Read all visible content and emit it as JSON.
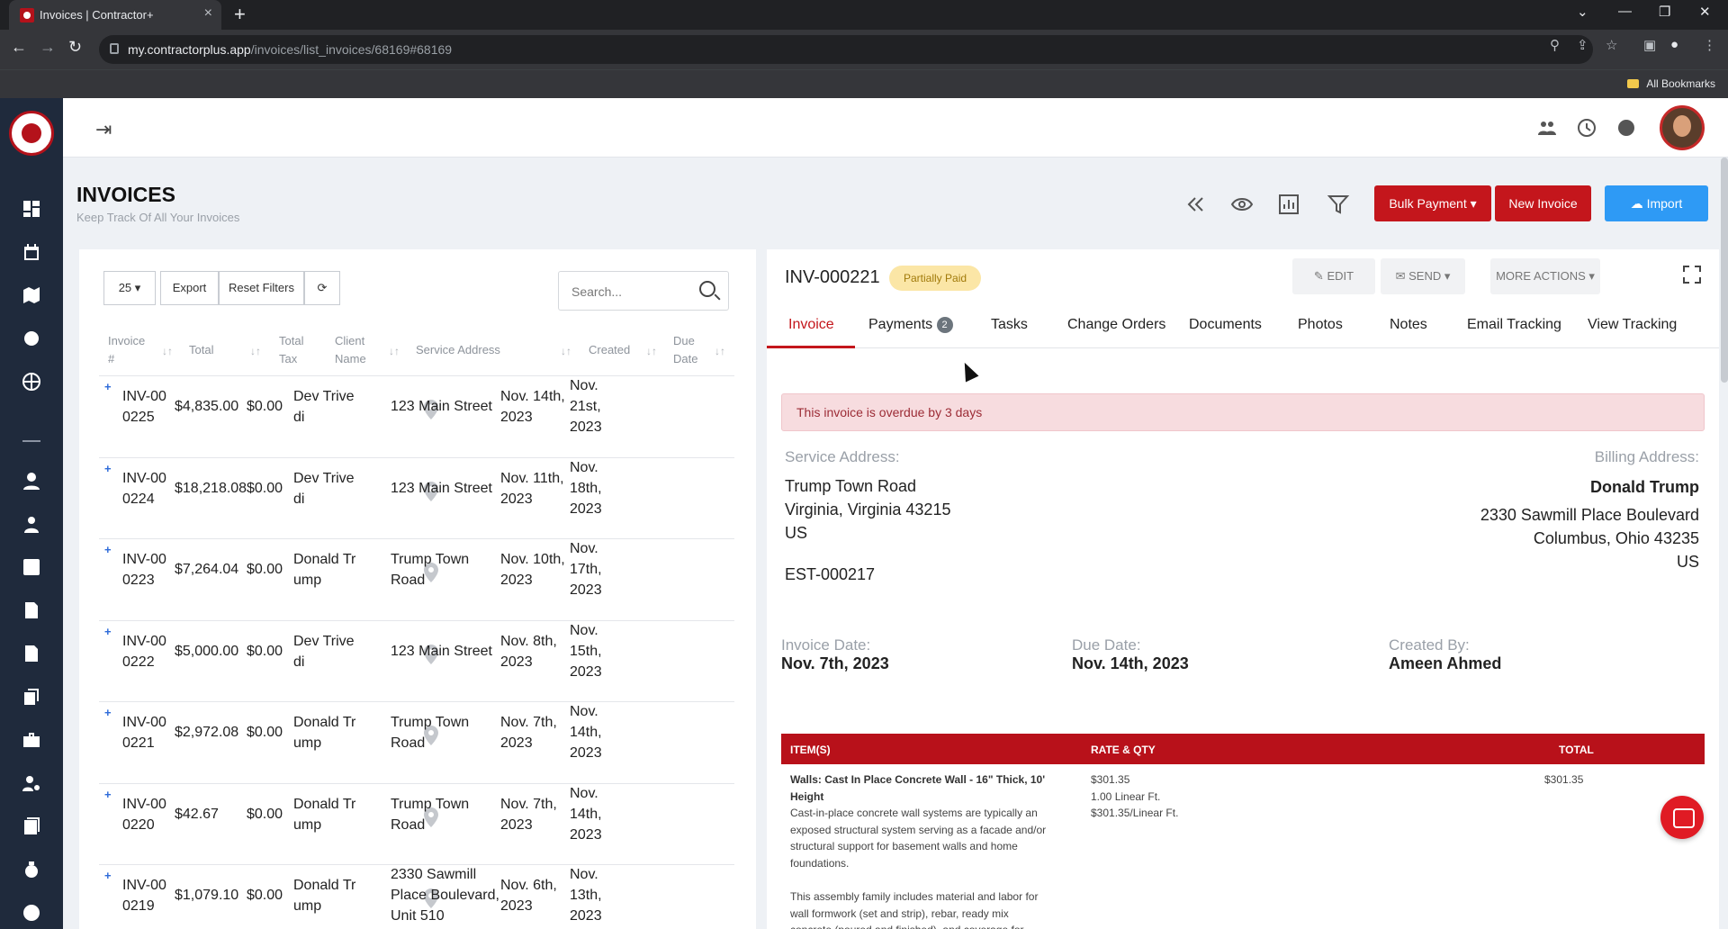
{
  "browser": {
    "tab_title": "Invoices | Contractor+",
    "tab_close": "×",
    "new_tab": "+",
    "url_host": "my.contractorplus.app",
    "url_path": "/invoices/list_invoices/68169#68169",
    "bookmarks_label": "All Bookmarks"
  },
  "page": {
    "title": "INVOICES",
    "subtitle": "Keep Track Of All Your Invoices"
  },
  "toolbar": {
    "bulk_payment": "Bulk Payment",
    "new_invoice": "New Invoice",
    "import": "Import"
  },
  "list": {
    "page_size": "25",
    "export": "Export",
    "reset_filters": "Reset Filters",
    "search_placeholder": "Search...",
    "headers": {
      "invoice_line1": "Invoice",
      "invoice_line2": "#",
      "total": "Total",
      "total_tax_line1": "Total",
      "total_tax_line2": "Tax",
      "client_line1": "Client",
      "client_line2": "Name",
      "service_address": "Service Address",
      "created": "Created",
      "due_line1": "Due",
      "due_line2": "Date"
    },
    "rows": [
      {
        "inv1": "INV-00",
        "inv2": "0225",
        "total": "$4,835.00",
        "tax": "$0.00",
        "client1": "Dev Trive",
        "client2": "di",
        "addr1": "123 Main Street",
        "addr2": "",
        "addr3": "",
        "created1": "Nov. 14th,",
        "created2": "2023",
        "due1": "Nov.",
        "due2": "21st,",
        "due3": "2023"
      },
      {
        "inv1": "INV-00",
        "inv2": "0224",
        "total": "$18,218.08",
        "tax": "$0.00",
        "client1": "Dev Trive",
        "client2": "di",
        "addr1": "123 Main Street",
        "addr2": "",
        "addr3": "",
        "created1": "Nov. 11th,",
        "created2": "2023",
        "due1": "Nov.",
        "due2": "18th,",
        "due3": "2023"
      },
      {
        "inv1": "INV-00",
        "inv2": "0223",
        "total": "$7,264.04",
        "tax": "$0.00",
        "client1": "Donald Tr",
        "client2": "ump",
        "addr1": "Trump Town",
        "addr2": "Road",
        "addr3": "",
        "created1": "Nov. 10th,",
        "created2": "2023",
        "due1": "Nov.",
        "due2": "17th,",
        "due3": "2023"
      },
      {
        "inv1": "INV-00",
        "inv2": "0222",
        "total": "$5,000.00",
        "tax": "$0.00",
        "client1": "Dev Trive",
        "client2": "di",
        "addr1": "123 Main Street",
        "addr2": "",
        "addr3": "",
        "created1": "Nov. 8th,",
        "created2": "2023",
        "due1": "Nov.",
        "due2": "15th,",
        "due3": "2023"
      },
      {
        "inv1": "INV-00",
        "inv2": "0221",
        "total": "$2,972.08",
        "tax": "$0.00",
        "client1": "Donald Tr",
        "client2": "ump",
        "addr1": "Trump Town",
        "addr2": "Road",
        "addr3": "",
        "created1": "Nov. 7th,",
        "created2": "2023",
        "due1": "Nov.",
        "due2": "14th,",
        "due3": "2023"
      },
      {
        "inv1": "INV-00",
        "inv2": "0220",
        "total": "$42.67",
        "tax": "$0.00",
        "client1": "Donald Tr",
        "client2": "ump",
        "addr1": "Trump Town",
        "addr2": "Road",
        "addr3": "",
        "created1": "Nov. 7th,",
        "created2": "2023",
        "due1": "Nov.",
        "due2": "14th,",
        "due3": "2023"
      },
      {
        "inv1": "INV-00",
        "inv2": "0219",
        "total": "$1,079.10",
        "tax": "$0.00",
        "client1": "Donald Tr",
        "client2": "ump",
        "addr1": "2330 Sawmill",
        "addr2": "Place Boulevard,",
        "addr3": "Unit 510",
        "created1": "Nov. 6th,",
        "created2": "2023",
        "due1": "Nov.",
        "due2": "13th,",
        "due3": "2023"
      }
    ]
  },
  "detail": {
    "invoice_number": "INV-000221",
    "status": "Partially Paid",
    "edit": "EDIT",
    "send": "SEND",
    "more_actions": "MORE ACTIONS",
    "tabs": [
      "Invoice",
      "Payments",
      "Tasks",
      "Change Orders",
      "Documents",
      "Photos",
      "Notes",
      "Email Tracking",
      "View Tracking"
    ],
    "payments_count": "2",
    "alert": "This invoice is overdue by 3 days",
    "service_address_label": "Service Address:",
    "service_address": [
      "Trump Town Road",
      "Virginia, Virginia 43215",
      "US"
    ],
    "estimate_ref": "EST-000217",
    "billing_address_label": "Billing Address:",
    "billing_name": "Donald Trump",
    "billing_address": [
      "2330 Sawmill Place Boulevard",
      "Columbus, Ohio 43235",
      "US"
    ],
    "invoice_date_label": "Invoice Date:",
    "invoice_date": "Nov. 7th, 2023",
    "due_date_label": "Due Date:",
    "due_date": "Nov. 14th, 2023",
    "created_by_label": "Created By:",
    "created_by": "Ameen Ahmed",
    "items_header": {
      "items": "ITEM(S)",
      "rate_qty": "RATE & QTY",
      "total": "TOTAL"
    },
    "item": {
      "title1": "Walls: Cast In Place Concrete Wall - 16\" Thick, 10'",
      "title2": "Height",
      "desc": [
        "Cast-in-place concrete wall systems are typically an",
        "exposed structural system serving as a facade and/or",
        "structural support for basement walls and home",
        "foundations."
      ],
      "desc2": [
        "This assembly family includes material and labor for",
        "wall formwork (set and strip), rebar, ready mix",
        "concrete (poured and finished), and coverage for"
      ],
      "rate": "$301.35",
      "qty": "1.00 Linear Ft.",
      "unit_rate": "$301.35/Linear Ft.",
      "total": "$301.35"
    }
  }
}
